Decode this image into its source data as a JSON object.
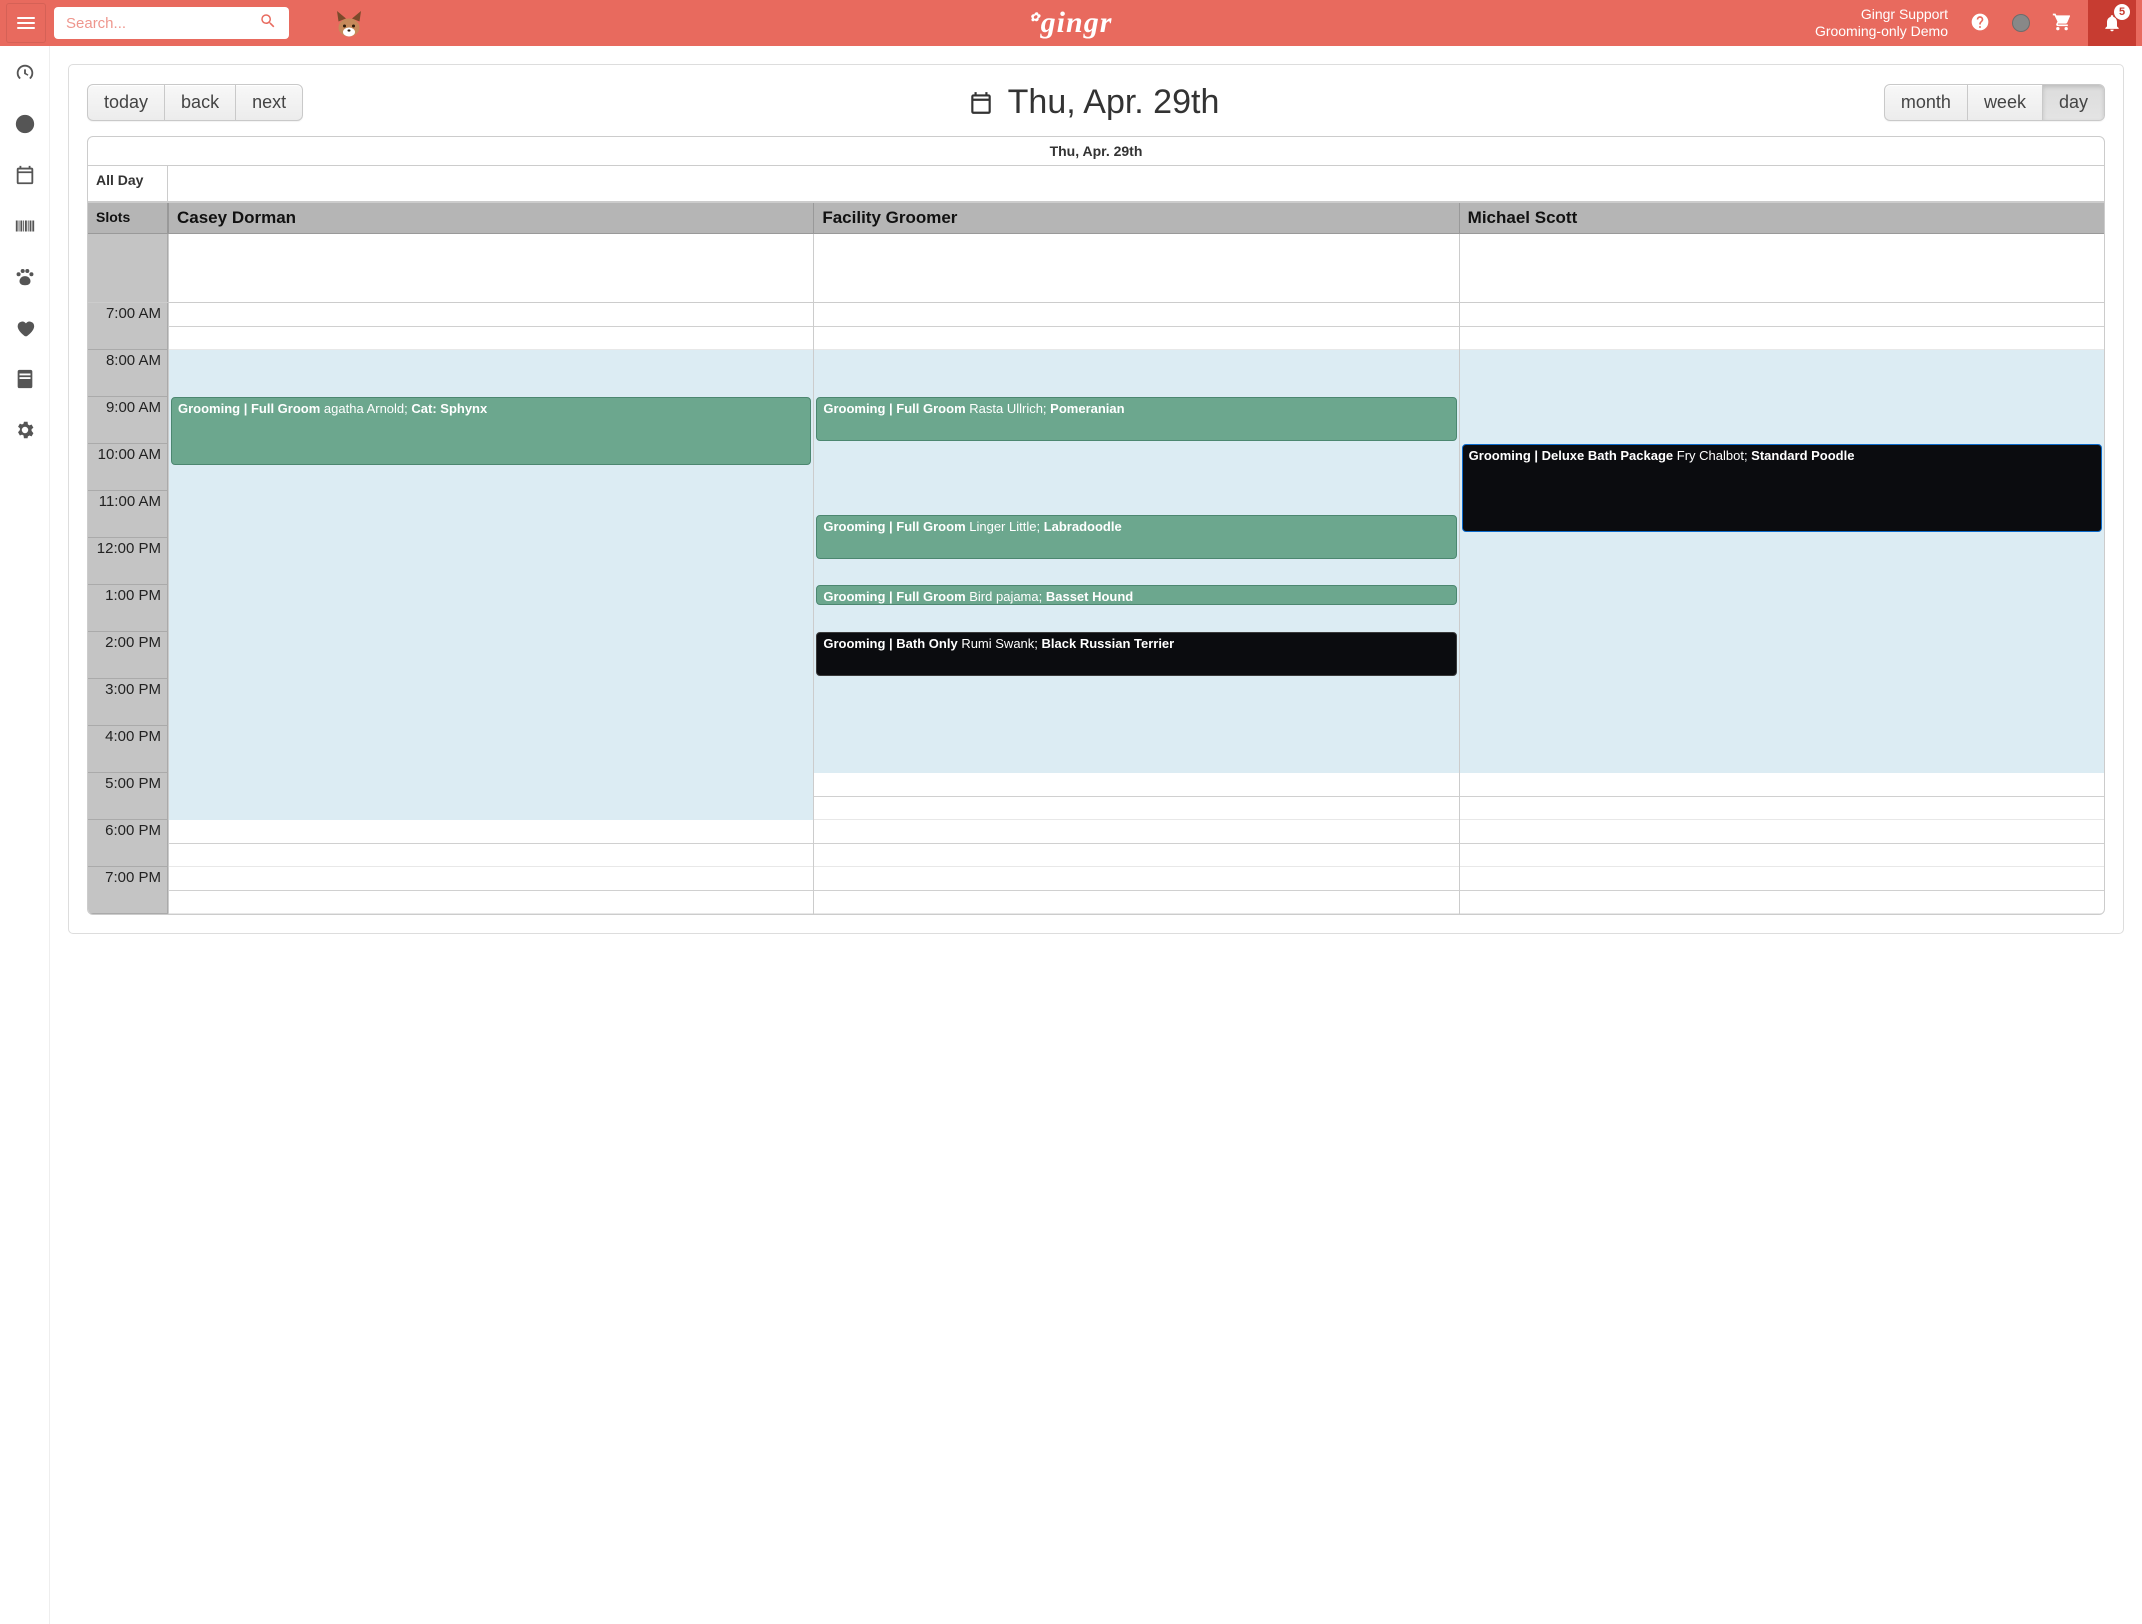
{
  "header": {
    "search_placeholder": "Search...",
    "brand": "gingr",
    "account_line1": "Gingr Support",
    "account_line2": "Grooming-only Demo",
    "notification_count": "5"
  },
  "toolbar": {
    "today": "today",
    "back": "back",
    "next": "next",
    "title": "Thu, Apr. 29th",
    "month": "month",
    "week": "week",
    "day": "day"
  },
  "calendar": {
    "date_header": "Thu, Apr. 29th",
    "all_day_label": "All Day",
    "slots_label": "Slots",
    "resources": [
      "Casey Dorman",
      "Facility Groomer",
      "Michael Scott"
    ],
    "hours": [
      "7:00 AM",
      "8:00 AM",
      "9:00 AM",
      "10:00 AM",
      "11:00 AM",
      "12:00 PM",
      "1:00 PM",
      "2:00 PM",
      "3:00 PM",
      "4:00 PM",
      "5:00 PM",
      "6:00 PM",
      "7:00 PM"
    ],
    "events": {
      "casey_1": {
        "service": "Grooming | Full Groom ",
        "client": "agatha Arnold; ",
        "breed": "Cat: Sphynx"
      },
      "fac_1": {
        "service": "Grooming | Full Groom ",
        "client": "Rasta Ullrich; ",
        "breed": "Pomeranian"
      },
      "fac_2": {
        "service": "Grooming | Full Groom ",
        "client": "Linger Little; ",
        "breed": "Labradoodle"
      },
      "fac_3": {
        "service": "Grooming | Full Groom ",
        "client": "Bird pajama; ",
        "breed": "Basset Hound"
      },
      "fac_4": {
        "service": "Grooming | Bath Only ",
        "client": "Rumi Swank; ",
        "breed": "Black Russian Terrier"
      },
      "mic_1": {
        "service": "Grooming | Deluxe Bath Package ",
        "client": "Fry Chalbot; ",
        "breed": "Standard Poodle"
      }
    }
  }
}
